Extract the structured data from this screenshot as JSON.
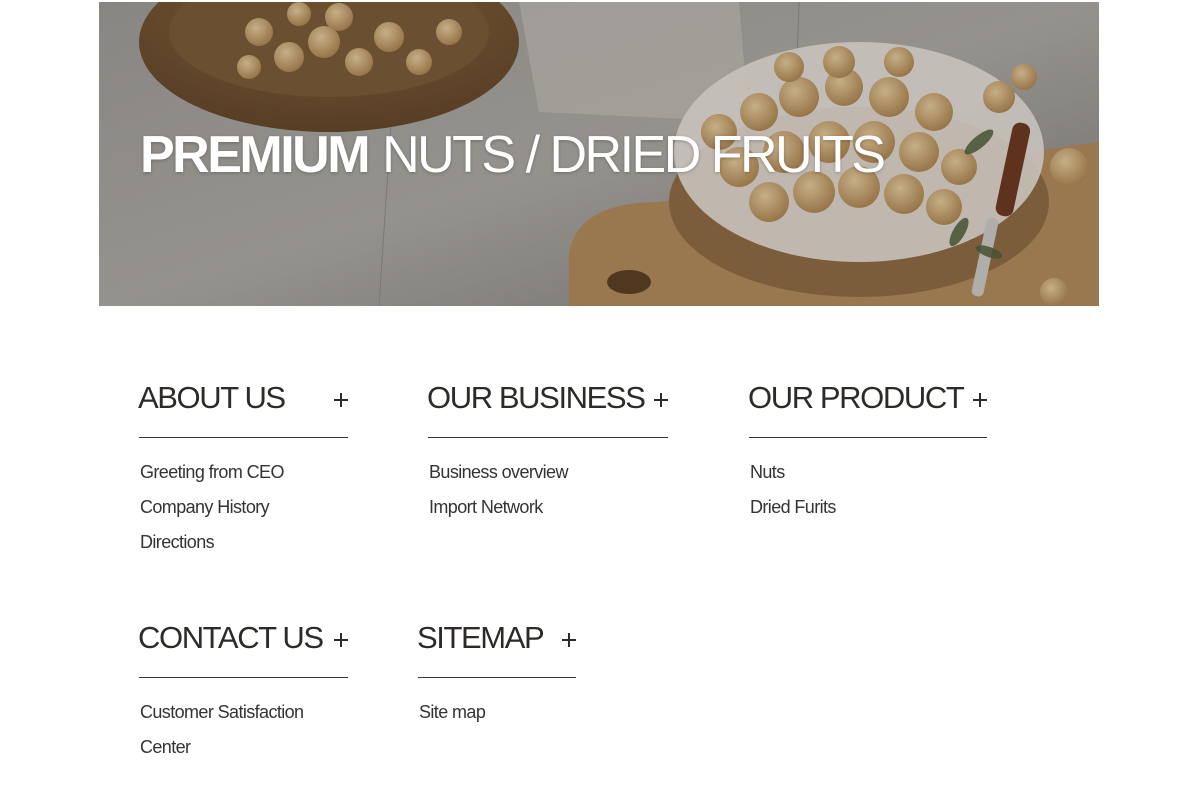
{
  "hero": {
    "title_strong": "PREMIUM",
    "title_light": "NUTS / DRIED FRUITS"
  },
  "menu_groups": [
    {
      "title": "ABOUT US",
      "expand_icon": "plus-icon",
      "items": [
        "Greeting from CEO",
        "Company History",
        "Directions"
      ]
    },
    {
      "title": "OUR BUSINESS",
      "expand_icon": "plus-icon",
      "items": [
        "Business overview",
        "Import Network"
      ]
    },
    {
      "title": "OUR PRODUCT",
      "expand_icon": "plus-icon",
      "items": [
        "Nuts",
        "Dried Furits"
      ]
    },
    {
      "title": "CONTACT US",
      "expand_icon": "plus-icon",
      "items": [
        "Customer Satisfaction Center"
      ]
    },
    {
      "title": "SITEMAP",
      "expand_icon": "plus-icon",
      "items": [
        "Site map"
      ]
    }
  ],
  "colors": {
    "text": "#2d2a28",
    "divider": "#333333",
    "hero_text": "#ffffff"
  }
}
